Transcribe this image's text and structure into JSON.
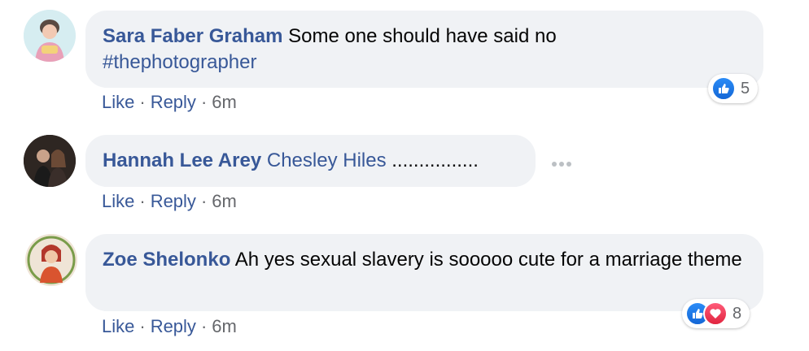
{
  "comments": [
    {
      "author": "Sara Faber Graham",
      "text": "Some one should have said no",
      "hashtag": "#thephotographer",
      "like_label": "Like",
      "reply_label": "Reply",
      "time": "6m",
      "reaction_count": "5",
      "reactions": [
        "like-icon"
      ]
    },
    {
      "author": "Hannah Lee Arey",
      "mention": "Chesley Hiles",
      "text": "................",
      "like_label": "Like",
      "reply_label": "Reply",
      "time": "6m"
    },
    {
      "author": "Zoe Shelonko",
      "text": "Ah yes sexual slavery is sooooo cute for a marriage theme",
      "like_label": "Like",
      "reply_label": "Reply",
      "time": "6m",
      "reaction_count": "8",
      "reactions": [
        "like-icon",
        "love-icon"
      ]
    }
  ],
  "colors": {
    "link": "#385898",
    "bubble_bg": "#f0f2f5",
    "meta": "#65676b",
    "like_blue": "#1877f2",
    "love_red": "#f33e58"
  }
}
